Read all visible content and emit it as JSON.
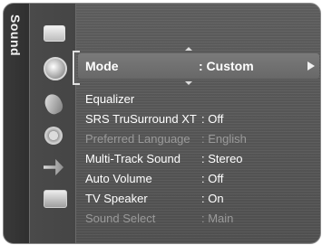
{
  "side_label": "Sound",
  "categories": [
    {
      "icon": "picture-icon"
    },
    {
      "icon": "sound-icon"
    },
    {
      "icon": "channel-icon"
    },
    {
      "icon": "setup-icon"
    },
    {
      "icon": "input-icon"
    },
    {
      "icon": "application-icon"
    }
  ],
  "menu": {
    "items": [
      {
        "label": "Mode",
        "value": ": Custom",
        "state": "selected"
      },
      {
        "label": "Equalizer",
        "value": "",
        "state": "enabled"
      },
      {
        "label": "SRS TruSurround XT",
        "value": ": Off",
        "state": "enabled"
      },
      {
        "label": "Preferred Language",
        "value": ": English",
        "state": "disabled"
      },
      {
        "label": "Multi-Track Sound",
        "value": ": Stereo",
        "state": "enabled"
      },
      {
        "label": "Auto Volume",
        "value": ": Off",
        "state": "enabled"
      },
      {
        "label": "TV Speaker",
        "value": ": On",
        "state": "enabled"
      },
      {
        "label": "Sound Select",
        "value": ": Main",
        "state": "disabled"
      }
    ]
  },
  "colors": {
    "background": "#555555",
    "text": "#ffffff",
    "disabled_text": "#9a9a9a",
    "highlight": "#707070"
  }
}
